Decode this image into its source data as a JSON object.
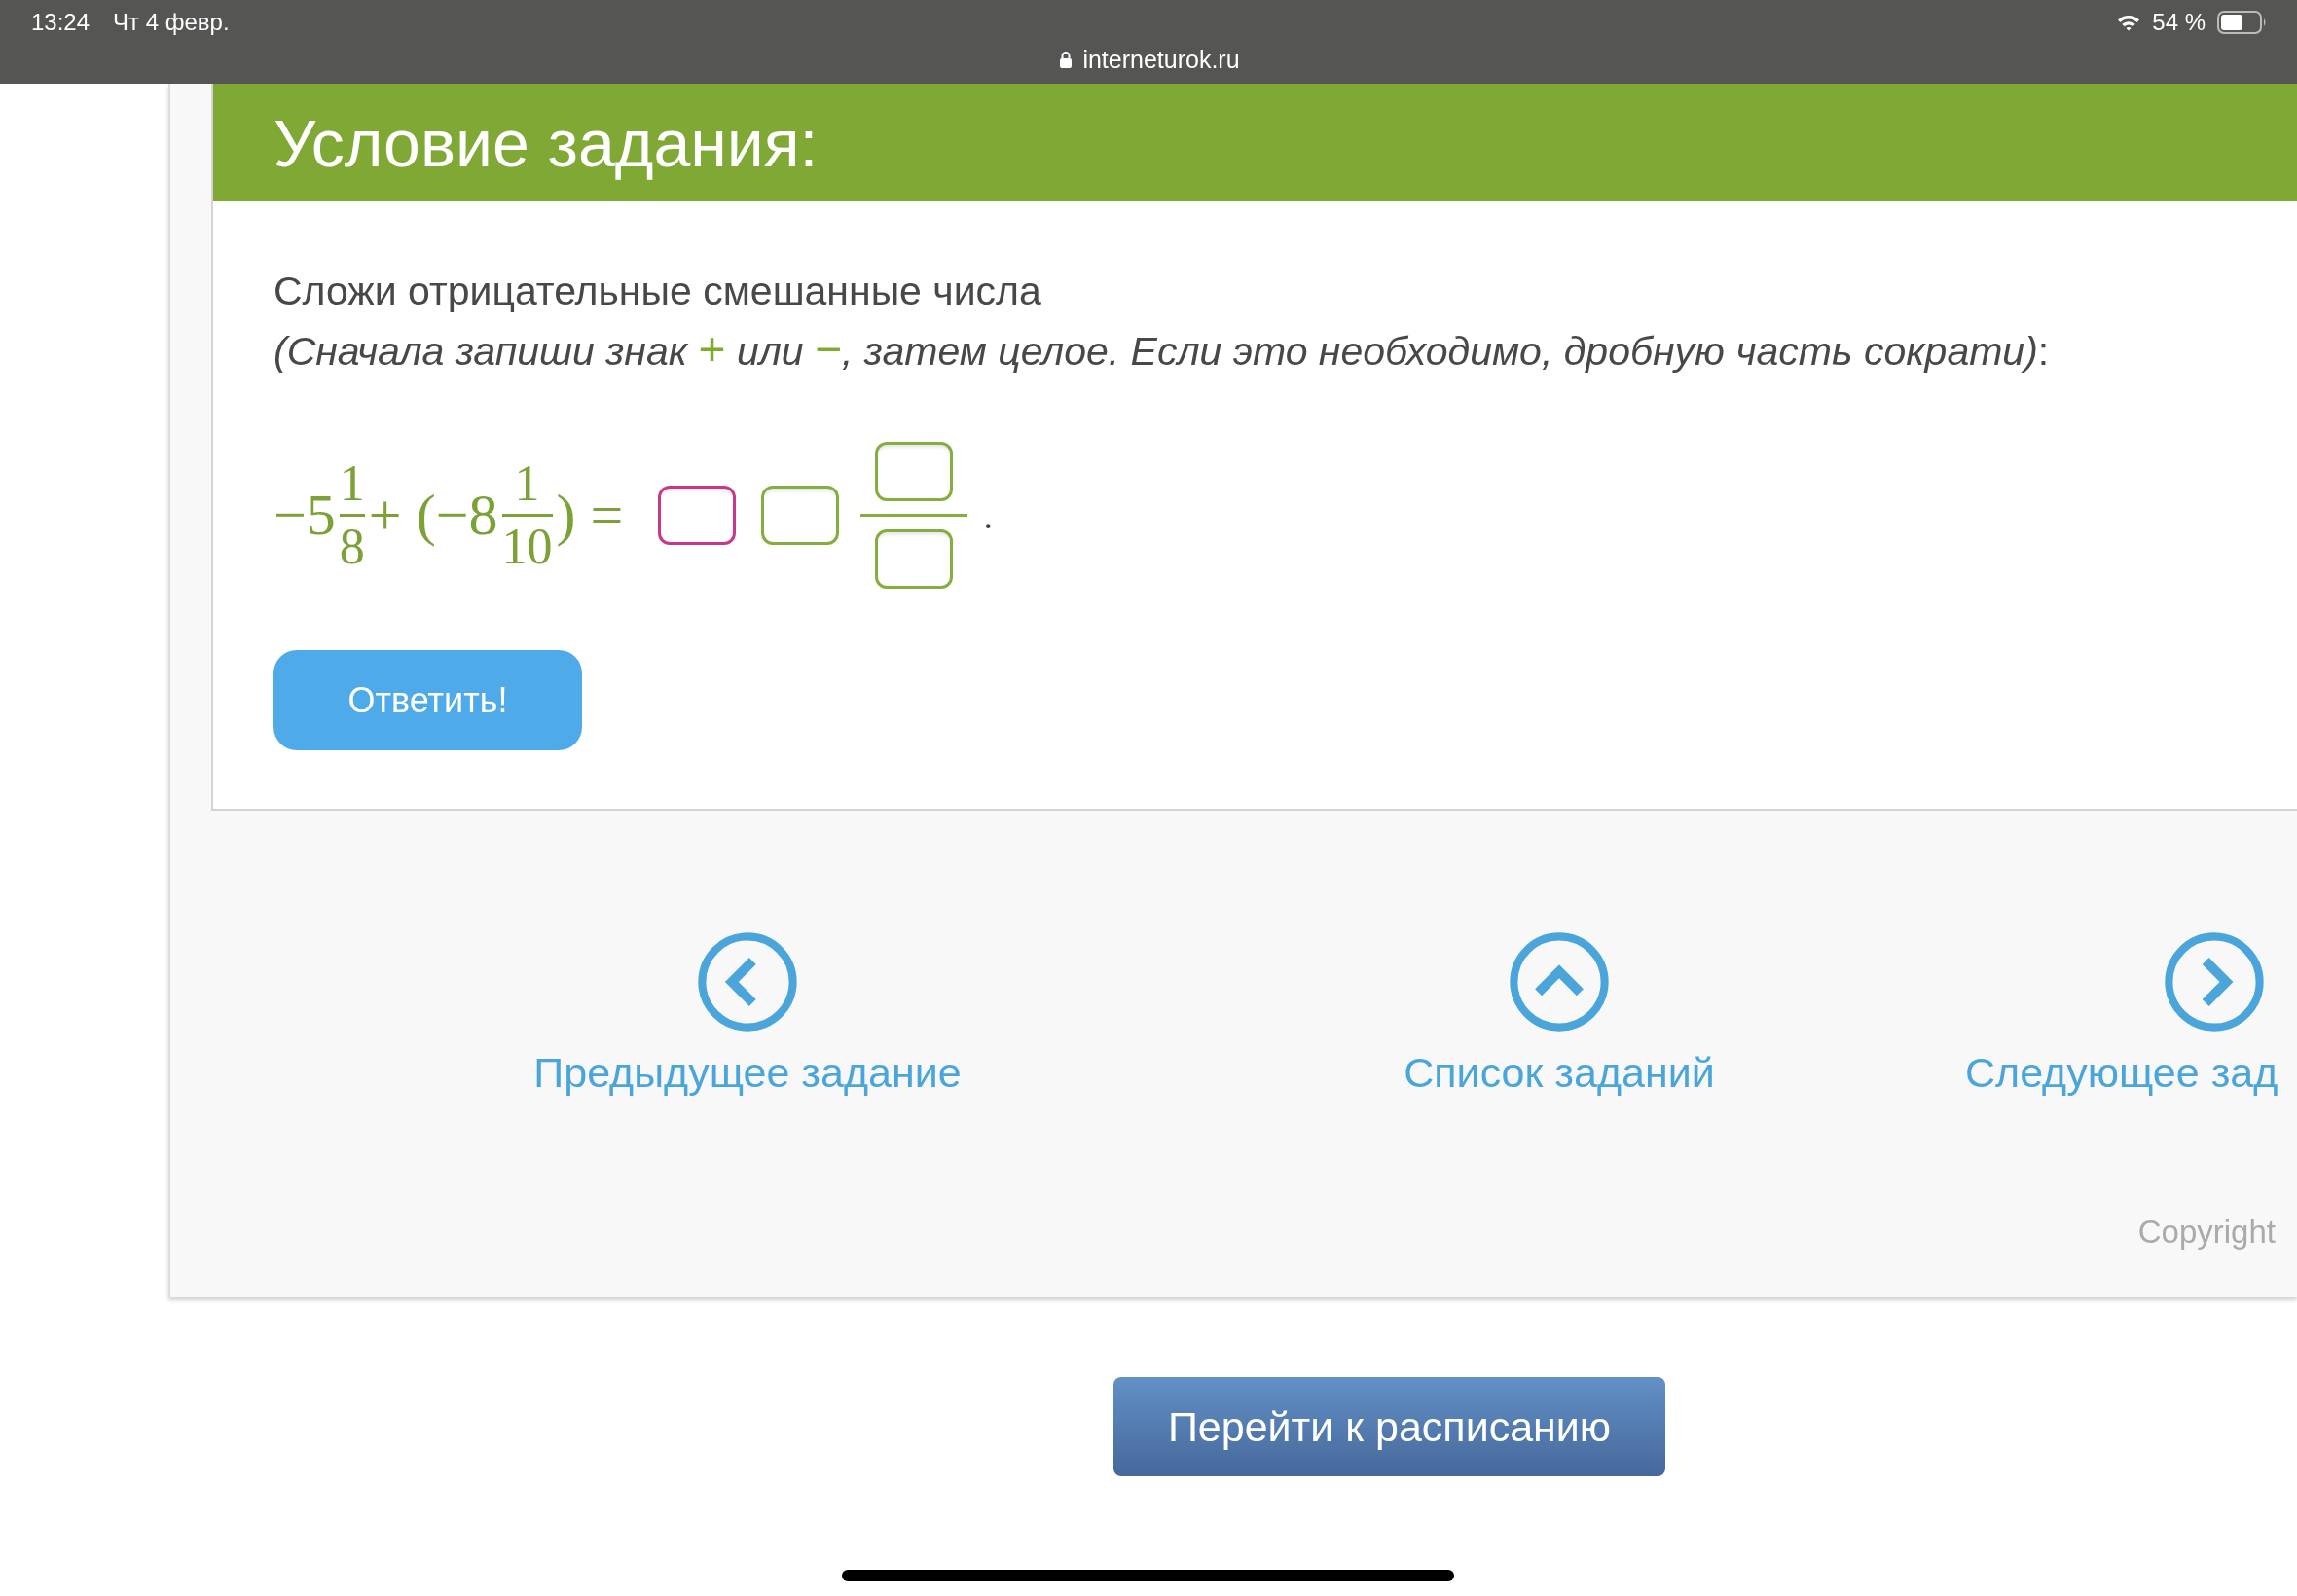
{
  "status_bar": {
    "time": "13:24",
    "date": "Чт 4 февр.",
    "url": "interneturok.ru",
    "battery": "54 %"
  },
  "task": {
    "title": "Условие задания:",
    "instruction": "Сложи отрицательные смешанные числа",
    "hint": [
      {
        "kind": "text",
        "text": "(Сначала запиши знак "
      },
      {
        "kind": "sign",
        "text": "+"
      },
      {
        "kind": "text",
        "text": " или "
      },
      {
        "kind": "sign",
        "text": "−"
      },
      {
        "kind": "text",
        "text": ", затем целое. Если это необходимо, дробную часть сократи)"
      },
      {
        "kind": "upright",
        "text": ":"
      }
    ],
    "expression": [
      {
        "kind": "text",
        "text": "−5"
      },
      {
        "kind": "fraction",
        "numerator": "1",
        "denominator": "8"
      },
      {
        "kind": "text",
        "text": "+ (−8"
      },
      {
        "kind": "fraction",
        "numerator": "1",
        "denominator": "10"
      },
      {
        "kind": "text",
        "text": ") ="
      }
    ],
    "answer_fields": [
      {
        "kind": "box",
        "focused": true
      },
      {
        "kind": "box",
        "focused": false
      },
      {
        "kind": "fraction",
        "numerator": {
          "focused": false
        },
        "denominator": {
          "focused": false
        }
      }
    ],
    "end_mark": ".",
    "submit_button": "Ответить!"
  },
  "navigation": [
    {
      "kind": "previous",
      "label": "Предыдущее задание"
    },
    {
      "kind": "list",
      "label": "Список заданий"
    },
    {
      "kind": "next",
      "label": "Следующее зад"
    }
  ],
  "copyright": "Copyright",
  "schedule_button": "Перейти к расписанию"
}
